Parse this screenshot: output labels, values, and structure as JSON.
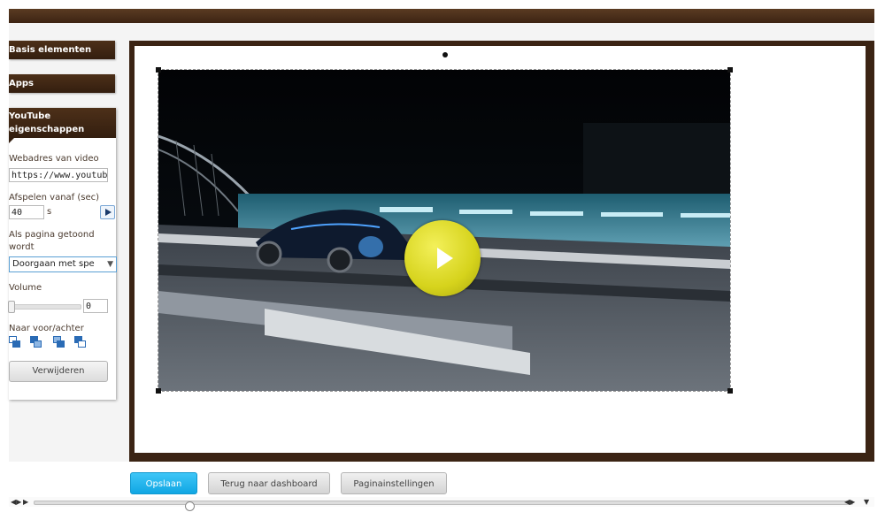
{
  "sidebar": {
    "basic_elements": "Basis elementen",
    "apps": "Apps",
    "youtube_props_title_1": "YouTube",
    "youtube_props_title_2": "eigenschappen",
    "video_url_label": "Webadres van video",
    "video_url_value": "https://www.youtube",
    "start_label": "Afspelen vanaf (sec)",
    "start_value": "40",
    "start_unit": "s",
    "on_show_label_1": "Als pagina getoond",
    "on_show_label_2": "wordt",
    "on_show_value": "Doorgaan met spe",
    "volume_label": "Volume",
    "volume_value": "0",
    "order_label": "Naar voor/achter",
    "delete_label": "Verwijderen"
  },
  "footer": {
    "save_label": "Opslaan",
    "back_label": "Terug naar dashboard",
    "page_settings_label": "Paginainstellingen"
  },
  "colors": {
    "brand_brown": "#3b2414",
    "primary_button": "#10a6e3",
    "play_yellow": "#d6d31c"
  },
  "icons": [
    "play-icon",
    "order-front-icon",
    "order-forward-icon",
    "order-backward-icon",
    "order-back-icon",
    "big-play-icon"
  ]
}
